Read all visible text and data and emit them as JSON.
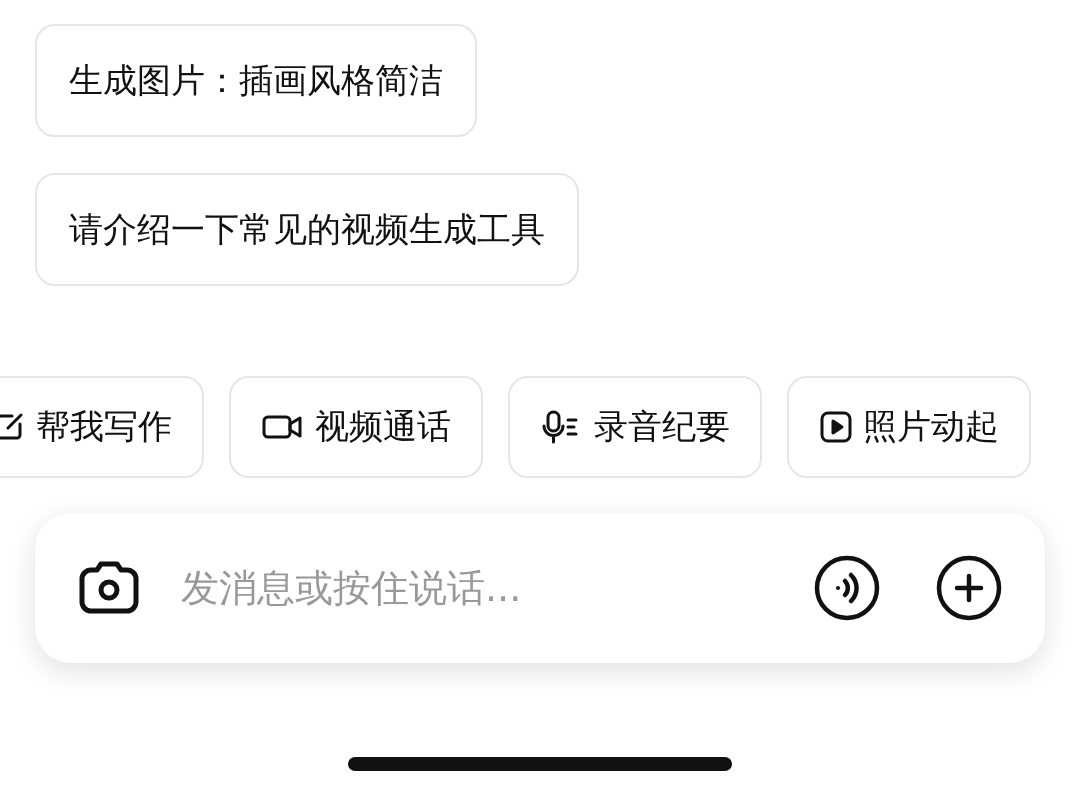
{
  "suggestions": [
    "生成图片：插画风格简洁",
    "请介绍一下常见的视频生成工具"
  ],
  "chips": [
    {
      "kind": "write",
      "label": "帮我写作"
    },
    {
      "kind": "video",
      "label": "视频通话"
    },
    {
      "kind": "record",
      "label": "录音纪要"
    },
    {
      "kind": "play",
      "label": "照片动起"
    }
  ],
  "input": {
    "placeholder": "发消息或按住说话..."
  }
}
